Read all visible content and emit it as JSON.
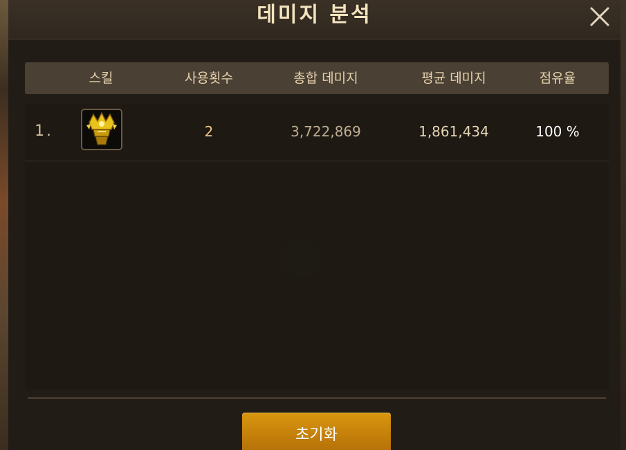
{
  "dialog": {
    "title": "데미지 분석"
  },
  "table": {
    "columns": [
      "스킬",
      "사용횟수",
      "총합 데미지",
      "평균 데미지",
      "점유율"
    ],
    "rows": [
      {
        "rank": "1.",
        "skill_icon": "golden-crown-skill-icon",
        "uses": "2",
        "total_damage": "3,722,869",
        "average_damage": "1,861,434",
        "share": "100 %"
      }
    ]
  },
  "footer": {
    "reset_label": "초기화"
  },
  "colors": {
    "title_text": "#f3e4bf",
    "header_bg": "#4b4034",
    "accent_button": "#d9960f",
    "uses_text": "#f0c987"
  }
}
